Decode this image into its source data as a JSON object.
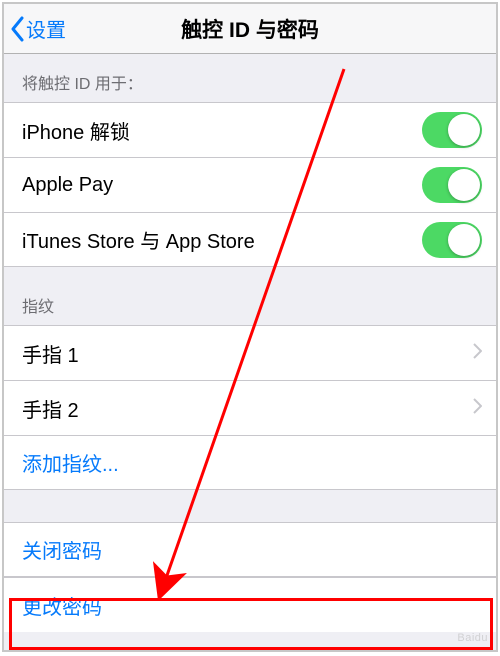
{
  "header": {
    "back_label": "设置",
    "title": "触控 ID 与密码"
  },
  "section_use_for": {
    "header": "将触控 ID 用于：",
    "items": [
      {
        "label": "iPhone 解锁",
        "on": true
      },
      {
        "label": "Apple Pay",
        "on": true
      },
      {
        "label": "iTunes Store 与 App Store",
        "on": true
      }
    ]
  },
  "section_fingerprints": {
    "header": "指纹",
    "items": [
      {
        "label": "手指 1"
      },
      {
        "label": "手指 2"
      }
    ],
    "add_label": "添加指纹..."
  },
  "section_passcode": {
    "turn_off_label": "关闭密码",
    "change_label": "更改密码"
  },
  "colors": {
    "link": "#057afb",
    "toggle_on": "#4cd964",
    "annotation": "#ff0000"
  }
}
